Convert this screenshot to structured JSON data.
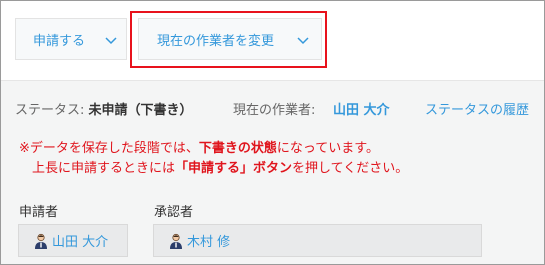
{
  "toolbar": {
    "apply_label": "申請する",
    "change_worker_label": "現在の作業者を変更"
  },
  "status": {
    "label": "ステータス:",
    "value": "未申請（下書き）",
    "worker_label": "現在の作業者:",
    "worker_value": "山田 大介",
    "history_link": "ステータスの履歴"
  },
  "notice": {
    "line1_prefix": "※データを保存した段階では、",
    "line1_bold": "下書きの状態",
    "line1_suffix": "になっています。",
    "line2_prefix": "上長に申請するときには",
    "line2_bold": "「申請する」ボタン",
    "line2_suffix": "を押してください。"
  },
  "applicant": {
    "label": "申請者",
    "name": "山田 大介"
  },
  "approver": {
    "label": "承認者",
    "name": "木村 修"
  },
  "colors": {
    "accent": "#3498db",
    "warning": "#e0151d",
    "highlight_box": "#e8121c"
  },
  "icons": {
    "dropdown": "chevron-down-icon",
    "user": "user-icon"
  }
}
